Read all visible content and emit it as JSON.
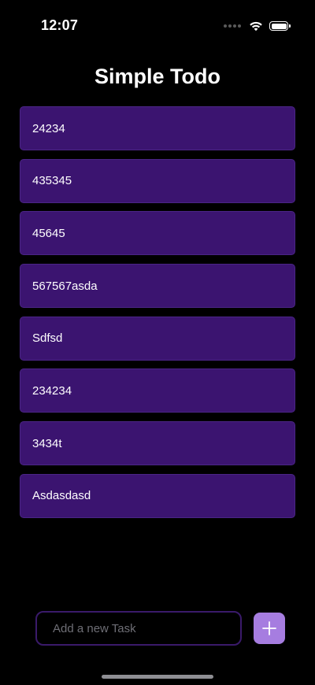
{
  "status_bar": {
    "time": "12:07"
  },
  "header": {
    "title": "Simple Todo"
  },
  "tasks": [
    {
      "label": "24234"
    },
    {
      "label": "435345"
    },
    {
      "label": "45645"
    },
    {
      "label": "567567asda"
    },
    {
      "label": "Sdfsd"
    },
    {
      "label": "234234"
    },
    {
      "label": "3434t"
    },
    {
      "label": "Asdasdasd"
    }
  ],
  "new_task": {
    "value": "",
    "placeholder": "Add a new Task"
  },
  "icons": {
    "add": "plus-icon",
    "wifi": "wifi-icon",
    "battery": "battery-icon",
    "signal": "signal-icon"
  },
  "colors": {
    "background": "#000000",
    "task_background": "#3b1470",
    "task_border": "#4a2585",
    "input_border": "#3a1a6a",
    "accent": "#a67de0",
    "text": "#ffffff",
    "placeholder": "#6e6e75"
  }
}
